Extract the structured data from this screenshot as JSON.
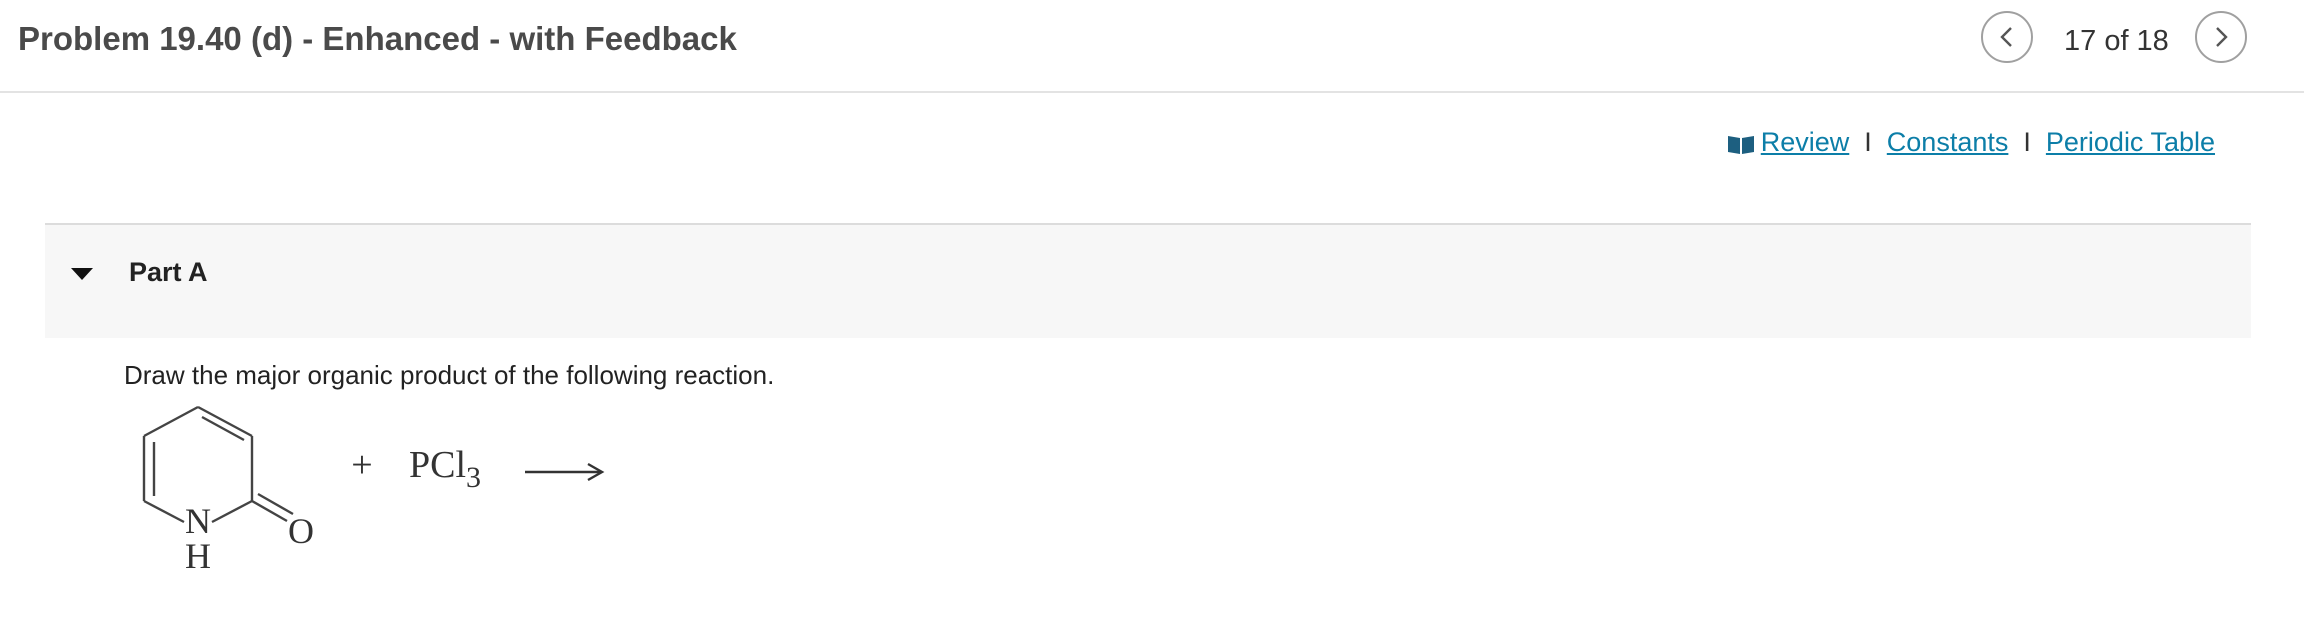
{
  "header": {
    "title": "Problem 19.40 (d) - Enhanced - with Feedback",
    "counter": "17 of 18"
  },
  "links": {
    "review": "Review",
    "separator": "I",
    "constants": "Constants",
    "periodic_table": "Periodic Table"
  },
  "part": {
    "label": "Part A",
    "question": "Draw the major organic product of the following reaction."
  },
  "reaction": {
    "nitrogen": "N",
    "hydrogen": "H",
    "oxygen": "O",
    "plus": "+",
    "reagent": "PCl",
    "reagent_subscript": "3"
  },
  "colors": {
    "link": "#0c7ea8",
    "title": "#4a4a4a",
    "panel_bg": "#f7f7f7"
  }
}
